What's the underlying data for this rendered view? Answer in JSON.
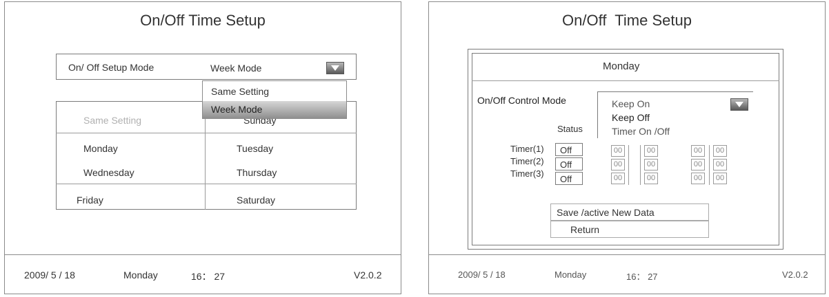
{
  "left_screen": {
    "title": "On/Off Time Setup",
    "mode_label": "On/ Off Setup Mode",
    "mode_value": "Week Mode",
    "dropdown_options": [
      "Same Setting",
      "Week Mode"
    ],
    "day_grid": {
      "header_left": "Same Setting",
      "header_right": "Sunday",
      "rows": [
        [
          "Monday",
          "Tuesday"
        ],
        [
          "Wednesday",
          "Thursday"
        ],
        [
          "Friday",
          "Saturday"
        ]
      ]
    },
    "status_bar": {
      "date": "2009/ 5 / 18",
      "weekday": "Monday",
      "time": "16： 27",
      "version": "V2.0.2"
    }
  },
  "right_screen": {
    "title": "On/Off  Time Setup",
    "day_title": "Monday",
    "control_mode_label": "On/Off Control Mode",
    "control_options": [
      "Keep On",
      "Keep Off",
      "Timer On /Off"
    ],
    "status_header": "Status",
    "timers": [
      {
        "label": "Timer(1)",
        "status": "Off",
        "values": [
          "00",
          "00",
          "00",
          "00"
        ]
      },
      {
        "label": "Timer(2)",
        "status": "Off",
        "values": [
          "00",
          "00",
          "00",
          "00"
        ]
      },
      {
        "label": "Timer(3)",
        "status": "Off",
        "values": [
          "00",
          "00",
          "00",
          "00"
        ]
      }
    ],
    "save_button": "Save /active New Data",
    "return_button": "Return",
    "status_bar": {
      "date": "2009/ 5 / 18",
      "weekday": "Monday",
      "time": "16： 27",
      "version": "V2.0.2"
    }
  }
}
